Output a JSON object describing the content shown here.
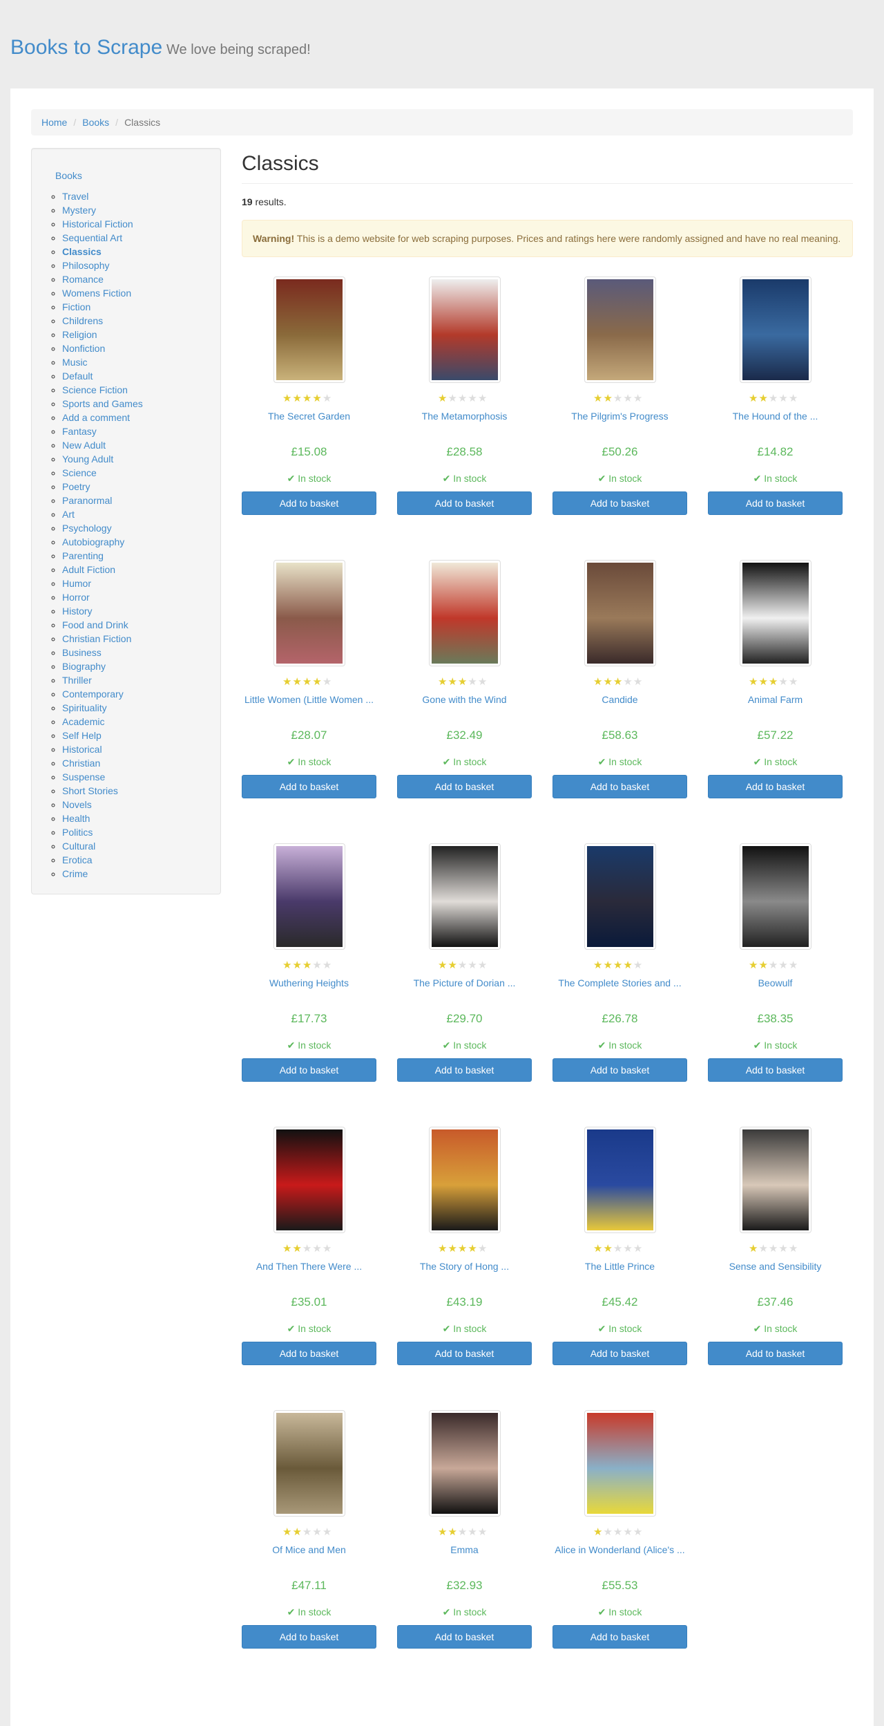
{
  "site": {
    "brand": "Books to Scrape",
    "tagline": "We love being scraped!"
  },
  "breadcrumb": {
    "home": "Home",
    "books": "Books",
    "current": "Classics"
  },
  "sidebar": {
    "root": "Books",
    "active": "Classics",
    "categories": [
      "Travel",
      "Mystery",
      "Historical Fiction",
      "Sequential Art",
      "Classics",
      "Philosophy",
      "Romance",
      "Womens Fiction",
      "Fiction",
      "Childrens",
      "Religion",
      "Nonfiction",
      "Music",
      "Default",
      "Science Fiction",
      "Sports and Games",
      "Add a comment",
      "Fantasy",
      "New Adult",
      "Young Adult",
      "Science",
      "Poetry",
      "Paranormal",
      "Art",
      "Psychology",
      "Autobiography",
      "Parenting",
      "Adult Fiction",
      "Humor",
      "Horror",
      "History",
      "Food and Drink",
      "Christian Fiction",
      "Business",
      "Biography",
      "Thriller",
      "Contemporary",
      "Spirituality",
      "Academic",
      "Self Help",
      "Historical",
      "Christian",
      "Suspense",
      "Short Stories",
      "Novels",
      "Health",
      "Politics",
      "Cultural",
      "Erotica",
      "Crime"
    ]
  },
  "main": {
    "heading": "Classics",
    "results_count": "19",
    "results_suffix": " results.",
    "warning_label": "Warning!",
    "warning_text": " This is a demo website for web scraping purposes. Prices and ratings here were randomly assigned and have no real meaning."
  },
  "colors": {
    "accent": "#428bca",
    "price": "#5cb85c",
    "star": "#e6ce31",
    "warning_bg": "#fcf8e3"
  },
  "books": [
    {
      "title": "The Secret Garden",
      "price": "£15.08",
      "rating": 4,
      "stock": "In stock",
      "button": "Add to basket",
      "cover": [
        "#7a2a1e",
        "#8a6a3a",
        "#c9b27a"
      ]
    },
    {
      "title": "The Metamorphosis",
      "price": "£28.58",
      "rating": 1,
      "stock": "In stock",
      "button": "Add to basket",
      "cover": [
        "#eee",
        "#b33a2a",
        "#3a4a6a"
      ]
    },
    {
      "title": "The Pilgrim's Progress",
      "price": "£50.26",
      "rating": 2,
      "stock": "In stock",
      "button": "Add to basket",
      "cover": [
        "#5a5a7a",
        "#8a6a4a",
        "#c4a87a"
      ]
    },
    {
      "title": "The Hound of the ...",
      "price": "£14.82",
      "rating": 2,
      "stock": "In stock",
      "button": "Add to basket",
      "cover": [
        "#1a3a6a",
        "#3a6aa0",
        "#1a2a4a"
      ]
    },
    {
      "title": "Little Women (Little Women ...",
      "price": "£28.07",
      "rating": 4,
      "stock": "In stock",
      "button": "Add to basket",
      "cover": [
        "#e8e2c8",
        "#8a5a4a",
        "#b4646a"
      ]
    },
    {
      "title": "Gone with the Wind",
      "price": "£32.49",
      "rating": 3,
      "stock": "In stock",
      "button": "Add to basket",
      "cover": [
        "#f0e8d8",
        "#c0382a",
        "#6a7a5a"
      ]
    },
    {
      "title": "Candide",
      "price": "£58.63",
      "rating": 3,
      "stock": "In stock",
      "button": "Add to basket",
      "cover": [
        "#6a4a3a",
        "#9a7a5a",
        "#3a2a2a"
      ]
    },
    {
      "title": "Animal Farm",
      "price": "£57.22",
      "rating": 3,
      "stock": "In stock",
      "button": "Add to basket",
      "cover": [
        "#111",
        "#f0f0f0",
        "#222"
      ]
    },
    {
      "title": "Wuthering Heights",
      "price": "£17.73",
      "rating": 3,
      "stock": "In stock",
      "button": "Add to basket",
      "cover": [
        "#c8b0d8",
        "#4a3a6a",
        "#2a2a2a"
      ]
    },
    {
      "title": "The Picture of Dorian ...",
      "price": "£29.70",
      "rating": 2,
      "stock": "In stock",
      "button": "Add to basket",
      "cover": [
        "#222",
        "#e0dcd8",
        "#111"
      ]
    },
    {
      "title": "The Complete Stories and ...",
      "price": "£26.78",
      "rating": 4,
      "stock": "In stock",
      "button": "Add to basket",
      "cover": [
        "#1a3a6a",
        "#2a2a3a",
        "#0a1a3a"
      ]
    },
    {
      "title": "Beowulf",
      "price": "£38.35",
      "rating": 2,
      "stock": "In stock",
      "button": "Add to basket",
      "cover": [
        "#111",
        "#8a8a8a",
        "#222"
      ]
    },
    {
      "title": "And Then There Were ...",
      "price": "£35.01",
      "rating": 2,
      "stock": "In stock",
      "button": "Add to basket",
      "cover": [
        "#111",
        "#c81a1a",
        "#1a1a1a"
      ]
    },
    {
      "title": "The Story of Hong ...",
      "price": "£43.19",
      "rating": 4,
      "stock": "In stock",
      "button": "Add to basket",
      "cover": [
        "#c85a2a",
        "#d8a03a",
        "#1a1a1a"
      ]
    },
    {
      "title": "The Little Prince",
      "price": "£45.42",
      "rating": 2,
      "stock": "In stock",
      "button": "Add to basket",
      "cover": [
        "#1a3a8a",
        "#2a4aa0",
        "#e8c83a"
      ]
    },
    {
      "title": "Sense and Sensibility",
      "price": "£37.46",
      "rating": 1,
      "stock": "In stock",
      "button": "Add to basket",
      "cover": [
        "#3a3a3a",
        "#d8c8b8",
        "#1a1a1a"
      ]
    },
    {
      "title": "Of Mice and Men",
      "price": "£47.11",
      "rating": 2,
      "stock": "In stock",
      "button": "Add to basket",
      "cover": [
        "#c8b89a",
        "#6a5a3a",
        "#a89878"
      ]
    },
    {
      "title": "Emma",
      "price": "£32.93",
      "rating": 2,
      "stock": "In stock",
      "button": "Add to basket",
      "cover": [
        "#3a2a2a",
        "#c8a898",
        "#111"
      ]
    },
    {
      "title": "Alice in Wonderland (Alice's ...",
      "price": "£55.53",
      "rating": 1,
      "stock": "In stock",
      "button": "Add to basket",
      "cover": [
        "#c83a2a",
        "#8ab0c8",
        "#e8d83a"
      ]
    }
  ]
}
